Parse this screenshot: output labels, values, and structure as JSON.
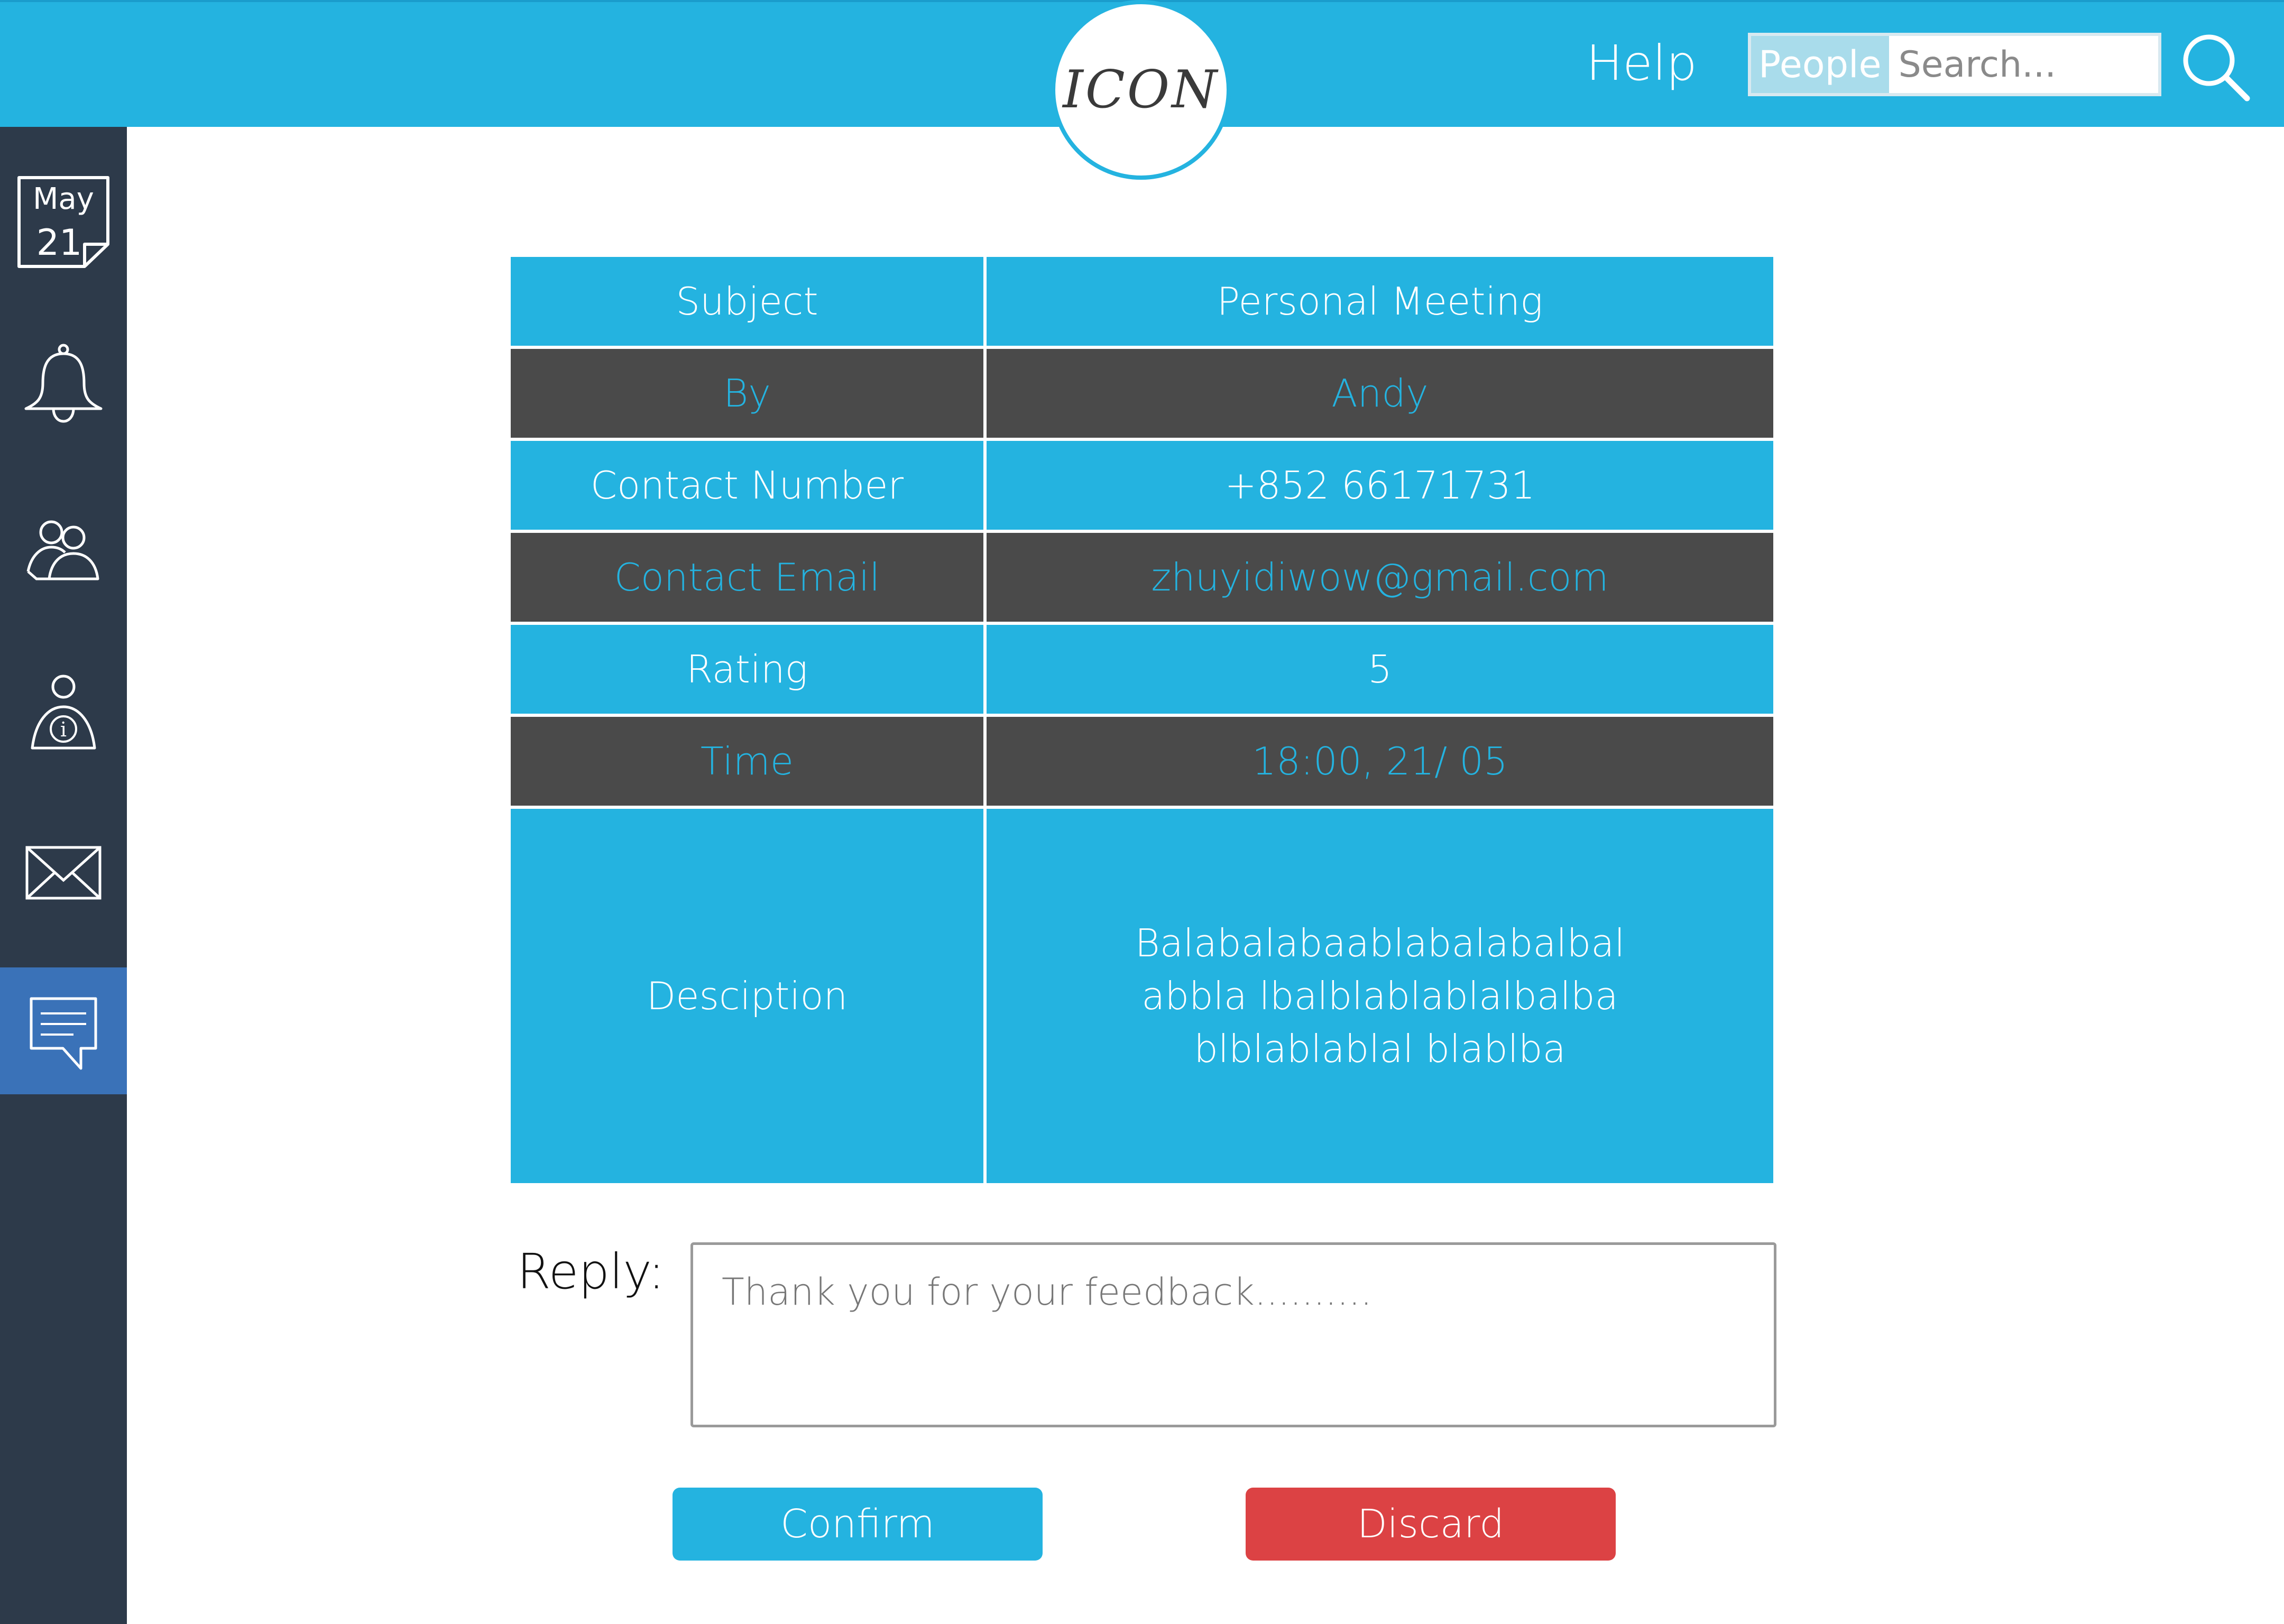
{
  "header": {
    "logo_text": "ICON",
    "help_label": "Help",
    "search": {
      "scope_label": "People",
      "placeholder": "Search..."
    }
  },
  "sidebar": {
    "calendar": {
      "month": "May",
      "day": "21"
    },
    "items": [
      {
        "icon": "calendar-icon"
      },
      {
        "icon": "bell-icon"
      },
      {
        "icon": "people-icon"
      },
      {
        "icon": "user-info-icon"
      },
      {
        "icon": "mail-icon"
      },
      {
        "icon": "chat-icon",
        "active": true
      }
    ]
  },
  "details": {
    "rows": [
      {
        "label": "Subject",
        "value": "Personal Meeting"
      },
      {
        "label": "By",
        "value": "Andy"
      },
      {
        "label": "Contact Number",
        "value": "+852 66171731"
      },
      {
        "label": "Contact Email",
        "value": "zhuyidiwow@gmail.com"
      },
      {
        "label": "Rating",
        "value": "5"
      },
      {
        "label": "Time",
        "value": "18:00, 21/ 05"
      },
      {
        "label": "Desciption",
        "value": "Balabalabaablabalabalbalabbla lbalblablablalbalbablblablablal blablba"
      }
    ]
  },
  "reply": {
    "label": "Reply:",
    "value": "Thank you for your feedback.........."
  },
  "actions": {
    "confirm_label": "Confirm",
    "discard_label": "Discard"
  },
  "colors": {
    "accent": "#24b3e0",
    "sidebar": "#2d3a4a",
    "sidebar_active": "#3a72b8",
    "row_dark": "#4a4a4a",
    "danger": "#dc4244"
  }
}
